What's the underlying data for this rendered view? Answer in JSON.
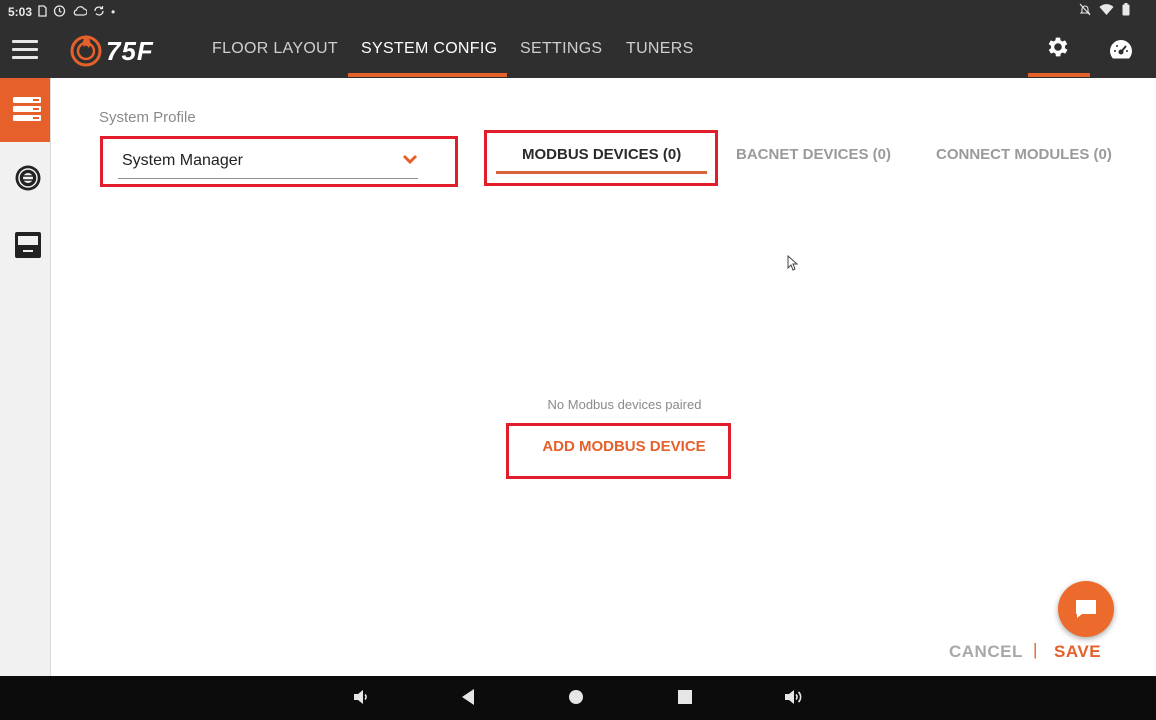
{
  "status_bar": {
    "time": "5:03",
    "dot": "•"
  },
  "app": {
    "logo_text": "75F"
  },
  "nav": {
    "items": [
      {
        "label": "FLOOR LAYOUT"
      },
      {
        "label": "SYSTEM CONFIG"
      },
      {
        "label": "SETTINGS"
      },
      {
        "label": "TUNERS"
      }
    ],
    "active_item": "SYSTEM CONFIG"
  },
  "system_profile": {
    "label": "System Profile",
    "selected_value": "System Manager"
  },
  "tabs": [
    {
      "label": "MODBUS DEVICES (0)",
      "active": true
    },
    {
      "label": "BACNET DEVICES (0)",
      "active": false
    },
    {
      "label": "CONNECT MODULES (0)",
      "active": false
    }
  ],
  "empty_state": {
    "message": "No Modbus devices paired",
    "add_button_label": "ADD MODBUS DEVICE"
  },
  "footer": {
    "cancel_label": "CANCEL",
    "separator": "|",
    "save_label": "SAVE"
  },
  "colors": {
    "accent": "#e5602a",
    "app_bar": "#2f2f2f",
    "highlight_box": "#e11d2b",
    "system_nav": "#0c0c0c"
  },
  "icons": {
    "status_left": [
      "sim-icon",
      "alarm-icon",
      "cloud-icon",
      "sync-icon"
    ],
    "status_right": [
      "notifications-off-icon",
      "wifi-icon",
      "battery-icon"
    ],
    "sidebar": [
      "system-list-icon",
      "dial-icon",
      "thermostat-icon"
    ],
    "app_bar_right": [
      "gear-icon",
      "dashboard-gauge-icon"
    ],
    "system_nav": [
      "volume-down-icon",
      "back-icon",
      "home-icon",
      "recents-icon",
      "volume-up-icon"
    ]
  }
}
